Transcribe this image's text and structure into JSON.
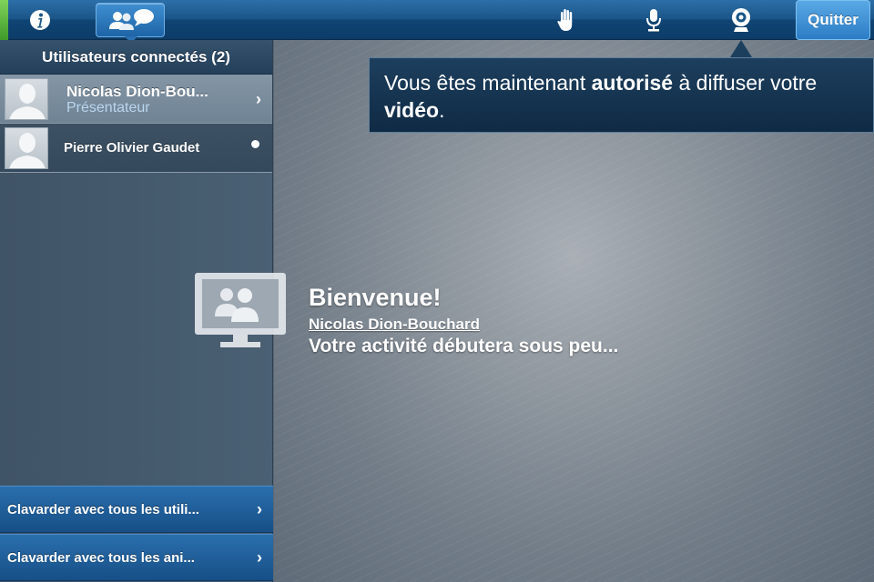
{
  "toolbar": {
    "info_icon": "info-icon",
    "users_icon": "users-chat-icon",
    "hand_icon": "raise-hand-icon",
    "mic_icon": "microphone-icon",
    "cam_icon": "webcam-icon",
    "quit_label": "Quitter"
  },
  "sidebar": {
    "header": "Utilisateurs connectés (2)",
    "users": [
      {
        "name": "Nicolas Dion-Bou...",
        "role": "Présentateur",
        "selected": true
      },
      {
        "name": "Pierre Olivier Gaudet",
        "role": "",
        "selected": false
      }
    ],
    "chat_buttons": [
      {
        "label": "Clavarder avec tous les utili..."
      },
      {
        "label": "Clavarder avec tous les ani..."
      }
    ]
  },
  "notice": {
    "prefix": "Vous êtes maintenant ",
    "bold1": "autorisé",
    "middle": " à diffuser votre ",
    "bold2": "vidéo",
    "suffix": "."
  },
  "welcome": {
    "title": "Bienvenue!",
    "name": "Nicolas Dion-Bouchard",
    "message": "Votre activité débutera sous peu..."
  },
  "colors": {
    "accent": "#1e64a6",
    "toolbar": "#1b5588",
    "green_edge": "#5bbf3f"
  }
}
